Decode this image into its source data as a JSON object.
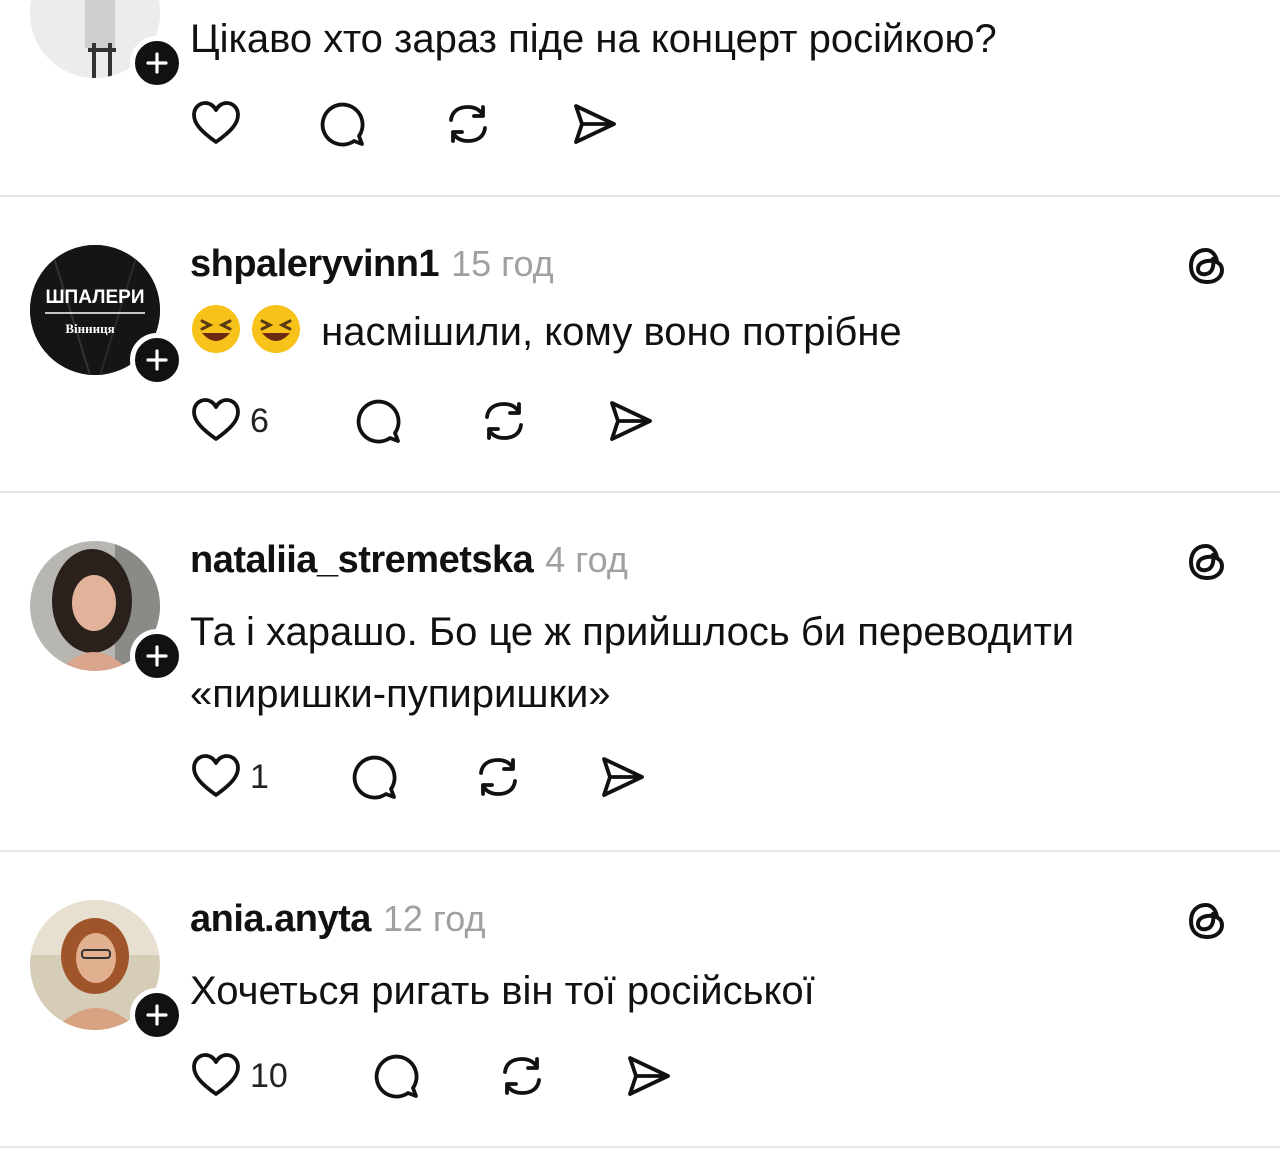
{
  "posts": [
    {
      "username": "",
      "time": "",
      "text": "Цікаво хто зараз піде на концерт російкою?",
      "likes": ""
    },
    {
      "username": "shpaleryvinn1",
      "time": "15 год",
      "emoji": "😆😆",
      "text": "насмішили, кому воно потрібне",
      "likes": "6",
      "avatar_text_top": "ШПАЛЕРИ",
      "avatar_text_bottom": "Вінниця"
    },
    {
      "username": "nataliia_stremetska",
      "time": "4 год",
      "text": "Та і харашо. Бо це ж прийшлось би переводити «пиришки-пупиришки»",
      "likes": "1"
    },
    {
      "username": "ania.anyta",
      "time": "12 год",
      "text": "Хочеться ригать він тої російської",
      "likes": "10"
    }
  ],
  "icons": {
    "like": "heart-icon",
    "reply": "comment-icon",
    "repost": "repost-icon",
    "share": "send-icon",
    "follow": "plus-icon",
    "app": "threads-icon"
  },
  "colors": {
    "text": "#111111",
    "muted": "#a0a0a0",
    "divider": "#e6e6e6"
  }
}
